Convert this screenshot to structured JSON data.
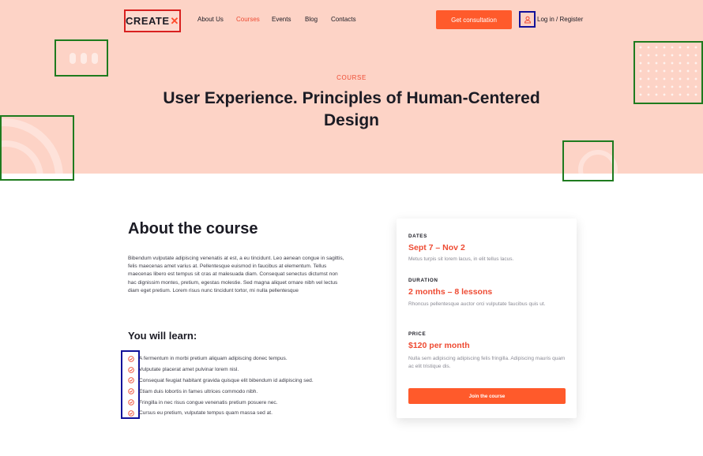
{
  "colors": {
    "accent": "#ff5a2b",
    "hero_bg": "#fdd3c6",
    "highlight_red": "#d8201f",
    "highlight_green": "#1e7b1e",
    "highlight_blue": "#12129a"
  },
  "nav": {
    "logo_text": "CREATE",
    "logo_mark": "✕",
    "links": [
      {
        "label": "About Us",
        "active": false
      },
      {
        "label": "Courses",
        "active": true
      },
      {
        "label": "Events",
        "active": false
      },
      {
        "label": "Blog",
        "active": false
      },
      {
        "label": "Contacts",
        "active": false
      }
    ],
    "cta_label": "Get consultation",
    "user_icon": "user-icon",
    "login_label": "Log in / Register"
  },
  "hero": {
    "kicker": "COURSE",
    "title": "User Experience. Principles of Human-Centered Design"
  },
  "about": {
    "heading": "About the course",
    "paragraph": "Bibendum vulputate adipiscing venenatis at est, a eu tincidunt. Leo aenean congue in sagittis, felis maecenas amet varius at. Pellentesque euismod in faucibus at elementum. Tellus maecenas libero est tempus sit cras at malesuada diam. Consequat senectus dictumst non hac dignissim montes, pretium, egestas molestie. Sed magna aliquet ornare nibh vel lectus diam eget pretium. Lorem risus nunc tincidunt tortor, mi nulla pellentesque"
  },
  "learn": {
    "heading": "You will learn:",
    "check_icon": "check-circle-icon",
    "items": [
      "A fermentum in morbi pretium aliquam adipiscing donec tempus.",
      "Vulputate placerat amet pulvinar lorem nisl.",
      "Consequat feugiat habitant gravida quisque elit bibendum id adipiscing sed.",
      "Etiam duis lobortis in fames ultrices commodo nibh.",
      "Fringilla in nec risus congue venenatis pretium posuere nec.",
      "Cursus eu pretium, vulputate tempus quam massa sed at."
    ]
  },
  "card": {
    "dates_label": "DATES",
    "dates_value": "Sept 7 – Nov 2",
    "dates_note": "Metus turpis sit lorem lacus, in elit tellus lacus.",
    "duration_label": "DURATION",
    "duration_value": "2 months – 8 lessons",
    "duration_note": "Rhoncus pellentesque auctor orci vulputate faucibus quis ut.",
    "price_label": "PRICE",
    "price_value": "$120 per month",
    "price_note": "Nulla sem adipiscing adipiscing felis fringilla. Adipiscing mauris quam ac elit tristique dis.",
    "join_label": "Join the course"
  }
}
